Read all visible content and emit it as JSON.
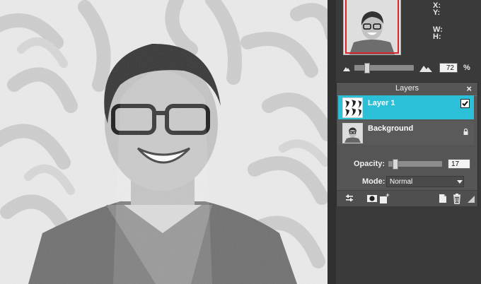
{
  "navigator": {
    "x_label": "X:",
    "y_label": "Y:",
    "w_label": "W:",
    "h_label": "H:",
    "zoom_value": "72",
    "zoom_unit": "%",
    "zoom_fraction": 0.2
  },
  "layers_panel": {
    "title": "Layers",
    "close_label": "×",
    "layers": [
      {
        "name": "Layer 1",
        "selected": true,
        "visible": true
      },
      {
        "name": "Background",
        "locked": true
      }
    ],
    "opacity_label": "Opacity:",
    "opacity_value": "17",
    "mode_label": "Mode:",
    "mode_value": "Normal"
  },
  "colors": {
    "selected_row": "#2bc0d7",
    "navigator_frame": "#d8262b",
    "panel_bg": "#555555",
    "dock_bg": "#3a3a3a"
  },
  "icons": [
    "mountain-small-icon",
    "mountain-large-icon",
    "lock-icon",
    "checkbox-icon",
    "adjustments-icon",
    "mask-icon",
    "add-layer-fx-icon",
    "new-layer-icon",
    "trash-icon",
    "resize-grip-icon"
  ]
}
